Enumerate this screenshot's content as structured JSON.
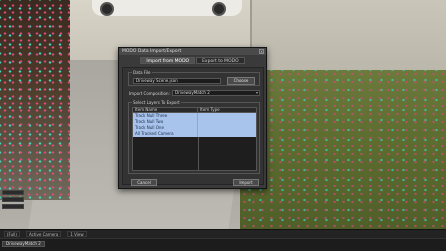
{
  "dialog": {
    "title": "MODO Data Import/Export",
    "close_glyph": "x",
    "tabs": [
      {
        "label": "Import from MODO",
        "active": true
      },
      {
        "label": "Export to MODO",
        "active": false
      }
    ],
    "data_file": {
      "group_label": "Data File",
      "path": "Driveway Scene.json",
      "choose_label": "Choose"
    },
    "composition": {
      "label": "Import Composition:",
      "selected": "DrivewayMatch 2",
      "chevron": "▾"
    },
    "layers": {
      "group_label": "Select Layers To Export",
      "columns": [
        "Item Name",
        "Item Type"
      ],
      "rows": [
        {
          "name": "Track Null Three",
          "type": ""
        },
        {
          "name": "Track Null Two",
          "type": ""
        },
        {
          "name": "Track Null One",
          "type": ""
        },
        {
          "name": "All Tracked Camera",
          "type": ""
        }
      ]
    },
    "cancel_label": "Cancel",
    "import_label": "Import"
  },
  "viewer_bar": {
    "items": [
      "(Full)",
      "Active Camera",
      "1 View"
    ]
  },
  "timeline": {
    "tab_label": "DrivewayMatch 2"
  },
  "colors": {
    "selection_row": "#a8c4ec",
    "dialog_bg": "#3a3a3a"
  }
}
